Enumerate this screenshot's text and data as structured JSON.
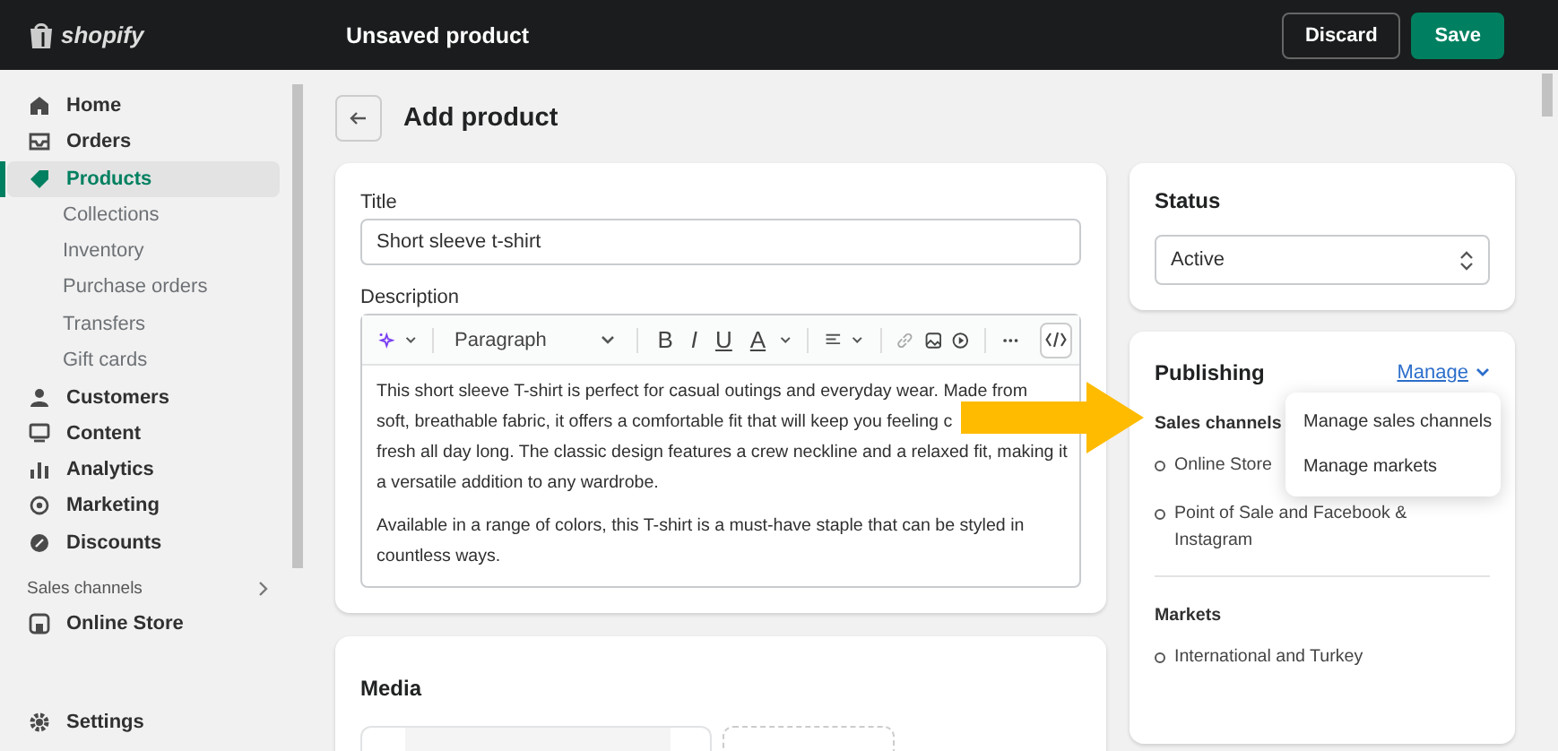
{
  "top_bar": {
    "logo": "shopify",
    "title": "Unsaved product",
    "buttons": [
      {
        "label": "Discard",
        "kind": "secondary"
      },
      {
        "label": "Save",
        "kind": "primary"
      }
    ]
  },
  "sidebar": {
    "items": [
      {
        "label": "Home",
        "selected": false
      },
      {
        "label": "Orders",
        "selected": false
      },
      {
        "label": "Products",
        "selected": true,
        "children": [
          {
            "label": "Collections"
          },
          {
            "label": "Inventory"
          },
          {
            "label": "Purchase orders"
          },
          {
            "label": "Transfers"
          },
          {
            "label": "Gift cards"
          }
        ]
      },
      {
        "label": "Customers",
        "selected": false
      },
      {
        "label": "Content",
        "selected": false
      },
      {
        "label": "Analytics",
        "selected": false
      },
      {
        "label": "Marketing",
        "selected": false
      },
      {
        "label": "Discounts",
        "selected": false
      }
    ],
    "section_title": "Sales channels",
    "channels": [
      {
        "label": "Online Store",
        "selected": false
      }
    ],
    "footer_item": {
      "label": "Settings",
      "selected": false
    }
  },
  "page": {
    "title": "Add product"
  },
  "product_card": {
    "title_label": "Title",
    "title_value": "Short sleeve t-shirt",
    "description_label": "Description",
    "toolbar": {
      "format": "Paragraph",
      "marks": [
        "B",
        "I",
        "U",
        "A"
      ]
    },
    "description": [
      [
        "This short sleeve T-shirt is perfect for casual outings and everyday wear. Made from",
        "soft, breathable fabric, it offers a comfortable fit that will keep you feeling c",
        "fresh all day long. The classic design features a crew neckline and a relaxed fit, making it",
        "a versatile addition to any wardrobe."
      ],
      [
        "Available in a range of colors, this T-shirt is a must-have staple that can be styled in",
        "countless ways."
      ]
    ]
  },
  "media_card": {
    "title": "Media"
  },
  "status_card": {
    "title": "Status",
    "value": "Active"
  },
  "publishing_card": {
    "title": "Publishing",
    "manage_link": "Manage",
    "menu": [
      "Manage sales channels",
      "Manage markets"
    ],
    "sales_channels_title": "Sales channels",
    "sales_channels": [
      "Online Store",
      "Point of Sale and Facebook & Instagram"
    ],
    "markets_title": "Markets",
    "markets": [
      "International and Turkey"
    ]
  }
}
